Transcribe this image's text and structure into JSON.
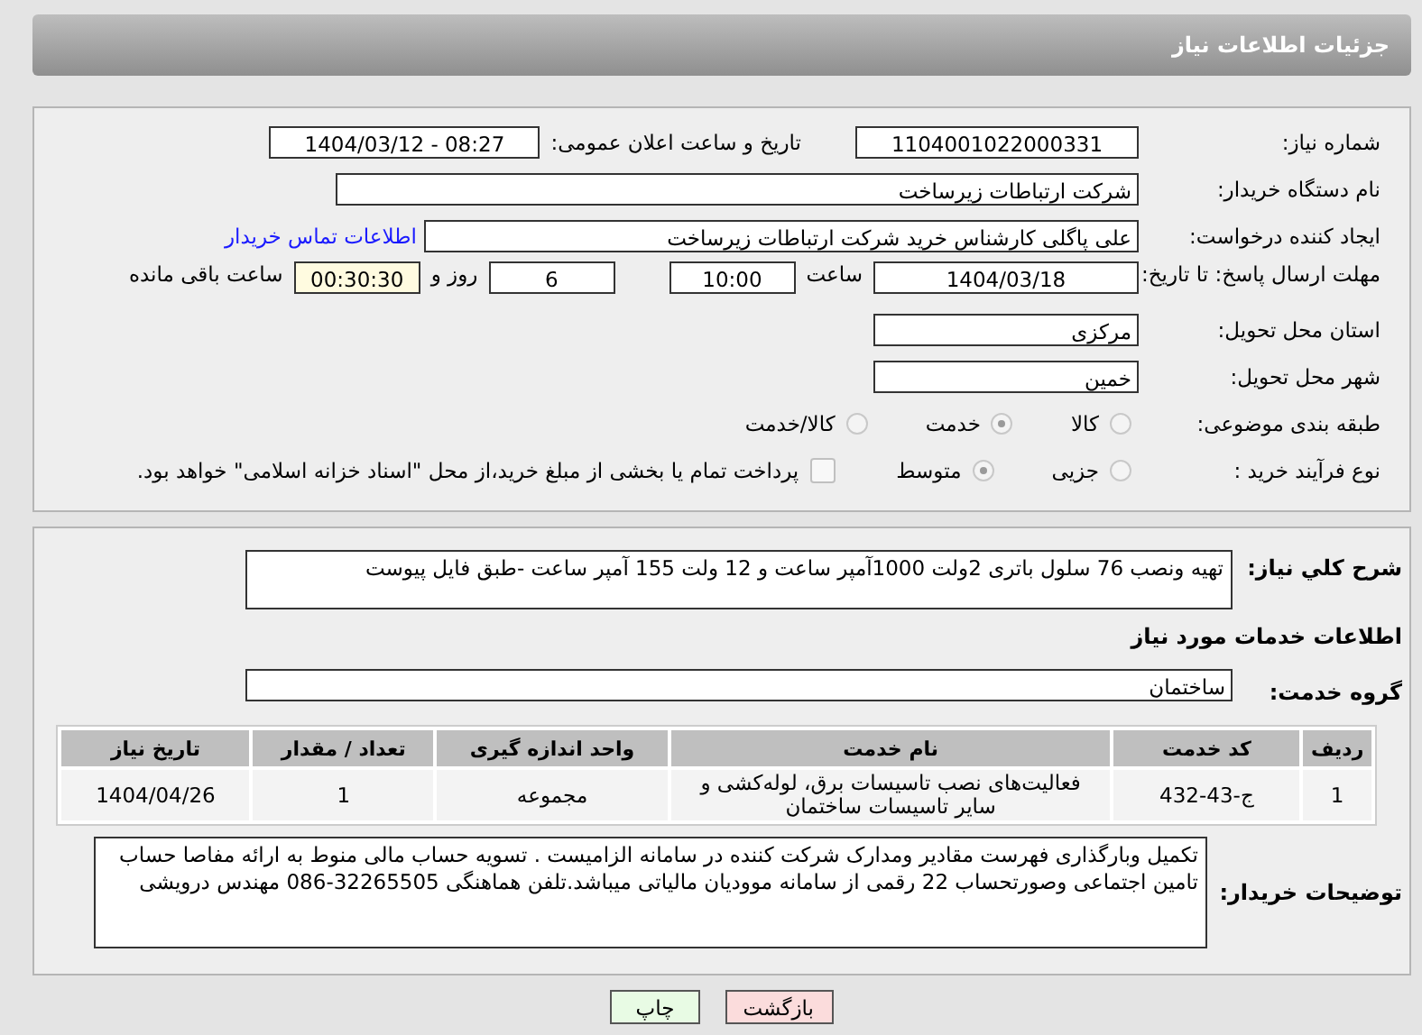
{
  "header": {
    "title": "جزئیات اطلاعات نیاز"
  },
  "need_number": {
    "label": "شماره نیاز:",
    "value": "1104001022000331"
  },
  "announce": {
    "label": "تاریخ و ساعت اعلان عمومی:",
    "value": "1404/03/12 - 08:27"
  },
  "buyer_org": {
    "label": "نام دستگاه خریدار:",
    "value": "شرکت ارتباطات زیرساخت"
  },
  "creator": {
    "label": "ایجاد کننده درخواست:",
    "value": "علی پاگلی کارشناس خرید شرکت ارتباطات زیرساخت",
    "link": "اطلاعات تماس خریدار"
  },
  "deadline": {
    "label": "مهلت ارسال پاسخ: تا تاریخ:",
    "date": "1404/03/18",
    "time_label": "ساعت",
    "time": "10:00",
    "days": "6",
    "days_label": "روز و",
    "remaining": "00:30:30",
    "remaining_label": "ساعت باقی مانده"
  },
  "province": {
    "label": "استان محل تحویل:",
    "value": "مرکزی"
  },
  "city": {
    "label": "شهر محل تحویل:",
    "value": "خمین"
  },
  "category": {
    "label": "طبقه بندی موضوعی:",
    "options": [
      {
        "label": "کالا",
        "selected": false
      },
      {
        "label": "خدمت",
        "selected": true
      },
      {
        "label": "کالا/خدمت",
        "selected": false
      }
    ]
  },
  "process": {
    "label": "نوع فرآیند خرید :",
    "options": [
      {
        "label": "جزیی",
        "selected": false
      },
      {
        "label": "متوسط",
        "selected": true
      }
    ],
    "payment": {
      "label": "پرداخت تمام یا بخشی از مبلغ خرید،از محل \"اسناد خزانه اسلامی\" خواهد بود.",
      "checked": false
    }
  },
  "description": {
    "label": "شرح کلي نياز:",
    "value": "تهیه ونصب 76 سلول باتری 2ولت 1000آمپر ساعت و 12 ولت 155 آمپر ساعت -طبق فایل پیوست"
  },
  "services_heading": "اطلاعات خدمات مورد نیاز",
  "service_group": {
    "label": "گروه خدمت:",
    "value": "ساختمان"
  },
  "table": {
    "columns": [
      "ردیف",
      "کد خدمت",
      "نام خدمت",
      "واحد اندازه گیری",
      "تعداد / مقدار",
      "تاریخ نیاز"
    ],
    "rows": [
      [
        "1",
        "ج-43-432",
        "فعالیت‌های نصب تاسیسات برق، لوله‌کشی و سایر تاسیسات ساختمان",
        "مجموعه",
        "1",
        "1404/04/26"
      ]
    ]
  },
  "buyer_notes": {
    "label": "توضیحات خریدار:",
    "value": "تکمیل وبارگذاری فهرست مقادیر ومدارک شرکت کننده در سامانه الزامیست . تسویه حساب مالی منوط به ارائه مفاصا حساب تامین اجتماعی وصورتحساب 22 رقمی از سامانه موودیان مالیاتی میباشد.تلفن هماهنگی 32265505-086 مهندس درویشی"
  },
  "buttons": [
    {
      "label": "بازگشت",
      "kind": "back"
    },
    {
      "label": "چاپ",
      "kind": "print"
    }
  ]
}
